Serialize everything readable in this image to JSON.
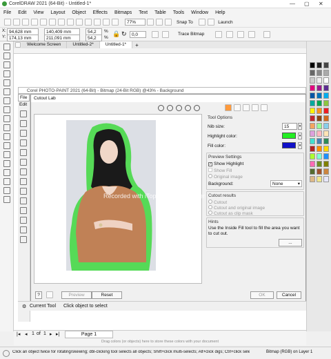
{
  "app_title": "CorelDRAW 2021 (64-Bit) - Untitled-1*",
  "menu": [
    "File",
    "Edit",
    "View",
    "Layout",
    "Object",
    "Effects",
    "Bitmaps",
    "Text",
    "Table",
    "Tools",
    "Window",
    "Help"
  ],
  "toolbar": {
    "zoom": "77%",
    "snap": "Snap To",
    "launch": "Launch"
  },
  "propbar": {
    "x": "94,628 mm",
    "y": "174,13 mm",
    "w": "140,409 mm",
    "h": "211,091 mm",
    "sx": "54,2",
    "sy": "54,2",
    "pct": "%",
    "angle": "0,0",
    "trace": "Trace Bitmap"
  },
  "doc_tabs": [
    "Welcome Screen",
    "Untitled-2*",
    "Untitled-1*"
  ],
  "photopaint": {
    "title": "Corel PHOTO-PAINT 2021 (64-Bit) - Bitmap (24-Bit RGB) @43% - Background",
    "menu": [
      "File",
      "Edit"
    ],
    "current_tool_label": "Current Tool",
    "current_tool_hint": "Click object to select"
  },
  "dialog": {
    "title": "Cutout Lab",
    "watermark": "Recorded with iTop Screen Recorder",
    "tool_options": "Tool Options",
    "nib_label": "Nib size:",
    "nib_value": "15",
    "highlight_label": "Highlight color:",
    "highlight_color": "#22ee22",
    "fill_label": "Fill color:",
    "fill_color": "#1010c8",
    "preview_settings": "Preview Settings",
    "show_highlight": "Show Highlight",
    "show_fill": "Show Fill",
    "original_image": "Original image",
    "background_label": "Background:",
    "background_value": "None",
    "cutout_results": "Cutout results",
    "cutout": "Cutout",
    "cutout_and_original": "Cutout and original image",
    "cutout_as_clip": "Cutout as clip mask",
    "hints": "Hints",
    "hint_text": "Use the Inside Fill tool to fill the area you want to cut out.",
    "more_button": "...",
    "preview_button": "Preview",
    "reset_button": "Reset",
    "ok_button": "OK",
    "cancel_button": "Cancel",
    "help_button": "?"
  },
  "page": {
    "current": "1",
    "of": "of",
    "total": "1",
    "tab": "Page 1"
  },
  "hint_bar": "Drag colors (or objects) here to store these colors with your document",
  "status_text": "Click an object twice for rotating/skewing; dbl-clicking tool selects all objects; Shift+click multi-selects; Alt+click digs; Ctrl+click selects in a group",
  "status_right": "Bitmap (RGB) on Layer 1",
  "palette": [
    "#000000",
    "#222222",
    "#444444",
    "#666666",
    "#888888",
    "#aaaaaa",
    "#cccccc",
    "#eeeeee",
    "#ffffff",
    "#e3007e",
    "#9b1b8f",
    "#5c2d91",
    "#0054a6",
    "#0072bc",
    "#00aeef",
    "#00a99d",
    "#00a651",
    "#8dc63f",
    "#fff200",
    "#f7941d",
    "#ed1c24",
    "#c1272d",
    "#8b4513",
    "#d2691e",
    "#f4a460",
    "#98fb98",
    "#87ceeb",
    "#dda0dd",
    "#ffb6c1",
    "#ffe4b5",
    "#40e0d0",
    "#4682b4",
    "#2e8b57",
    "#b22222",
    "#ff8c00",
    "#ffd700",
    "#adff2f",
    "#7fffd4",
    "#1e90ff",
    "#ff69b4",
    "#6b8e23",
    "#808000",
    "#556b2f",
    "#a0522d",
    "#cd853f",
    "#deb887",
    "#f0e68c",
    "#e6e6fa"
  ]
}
